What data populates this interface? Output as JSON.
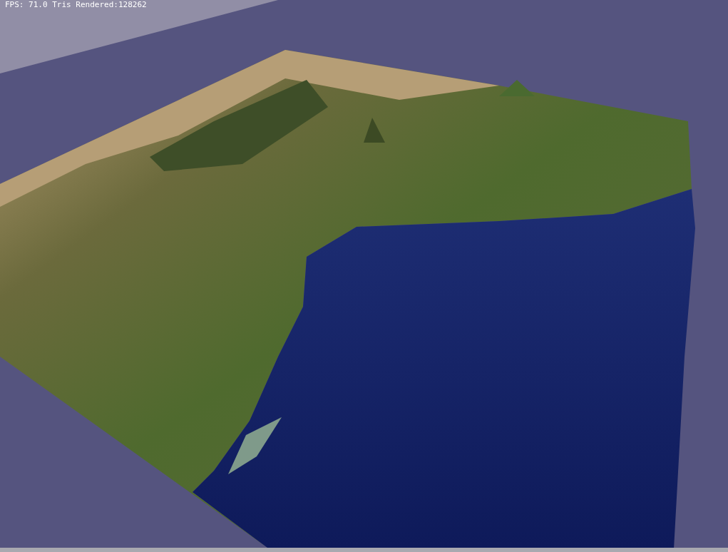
{
  "viewport": {
    "overlay_text": "FPS: 71.0 Tris Rendered:128262"
  }
}
